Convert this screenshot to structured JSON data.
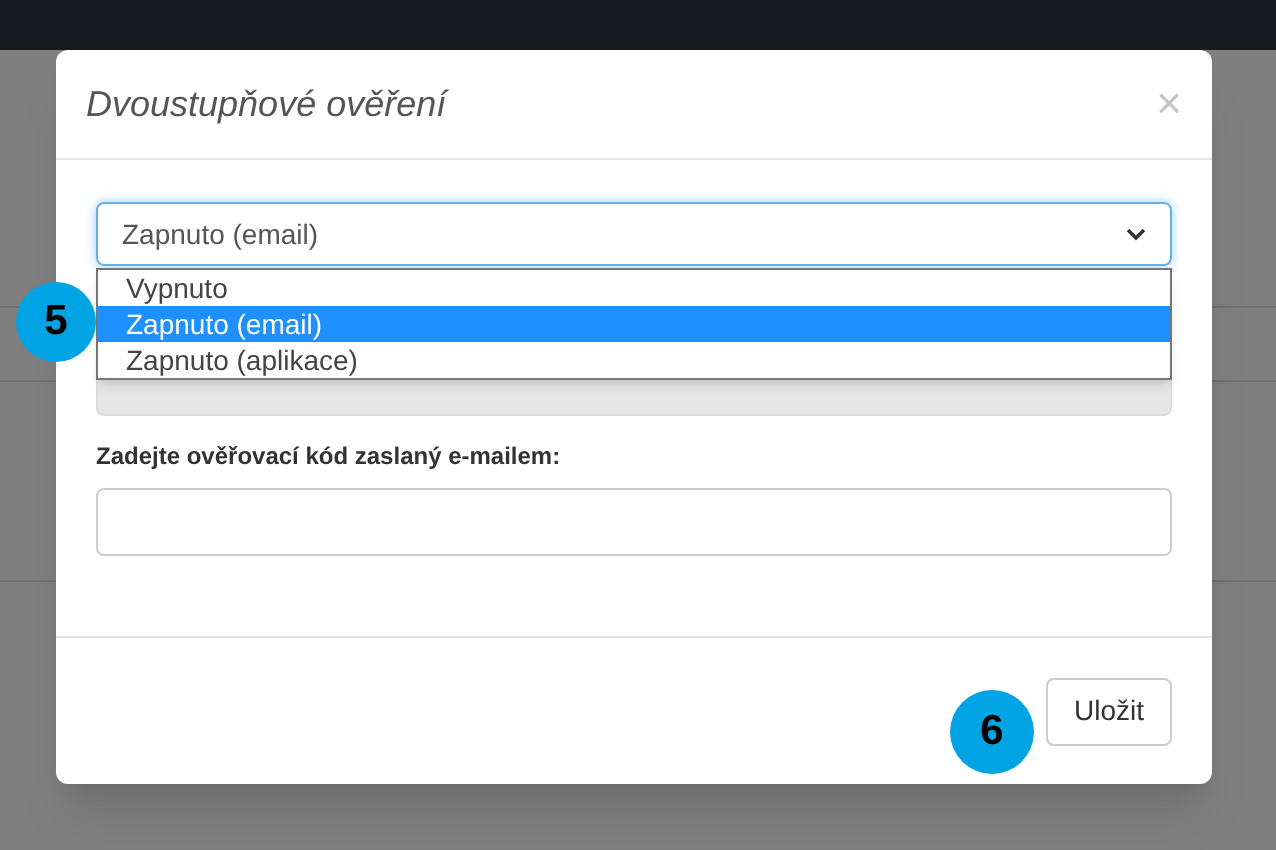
{
  "dialog": {
    "title": "Dvoustupňové ověření",
    "close": "×"
  },
  "mode_select": {
    "value": "Zapnuto (email)",
    "expanded": true,
    "options": [
      {
        "label": "Vypnuto",
        "selected": false
      },
      {
        "label": "Zapnuto (email)",
        "selected": true
      },
      {
        "label": "Zapnuto (aplikace)",
        "selected": false
      }
    ]
  },
  "code_label": "Zadejte ověřovací kód zaslaný e-mailem:",
  "save_button": "Uložit",
  "step_markers": [
    "5",
    "6"
  ]
}
